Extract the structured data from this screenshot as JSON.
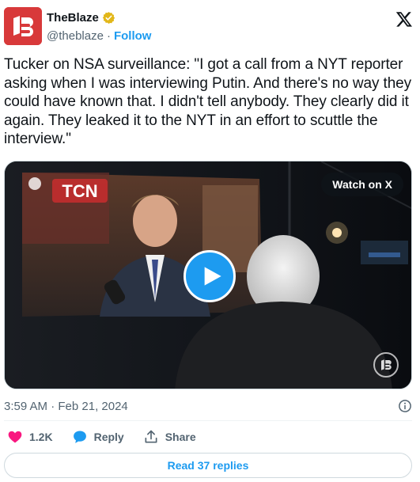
{
  "author": {
    "name": "TheBlaze",
    "handle": "@theblaze",
    "separator": "·",
    "follow_label": "Follow",
    "verified_color": "#e2b719",
    "avatar_color": "#d8393a"
  },
  "tweet": {
    "text": "Tucker on NSA surveillance: \"I got a call from a NYT reporter asking when I was interviewing Putin. And there's no way they could have known that. I didn't tell anybody. They clearly did it again. They leaked it to the NYT in an effort to scuttle the interview.\"",
    "timestamp": "3:59 AM · Feb 21, 2024"
  },
  "media": {
    "watch_label": "Watch on X",
    "channel_logo_text": "TCN",
    "play_icon": "play-icon"
  },
  "actions": {
    "like_count": "1.2K",
    "reply_label": "Reply",
    "share_label": "Share",
    "like_color": "#f91880",
    "reply_color": "#1d9bf0"
  },
  "replies_button": {
    "label": "Read 37 replies"
  },
  "colors": {
    "accent": "#1d9bf0",
    "secondary_text": "#536471",
    "primary_text": "#0f1419"
  }
}
